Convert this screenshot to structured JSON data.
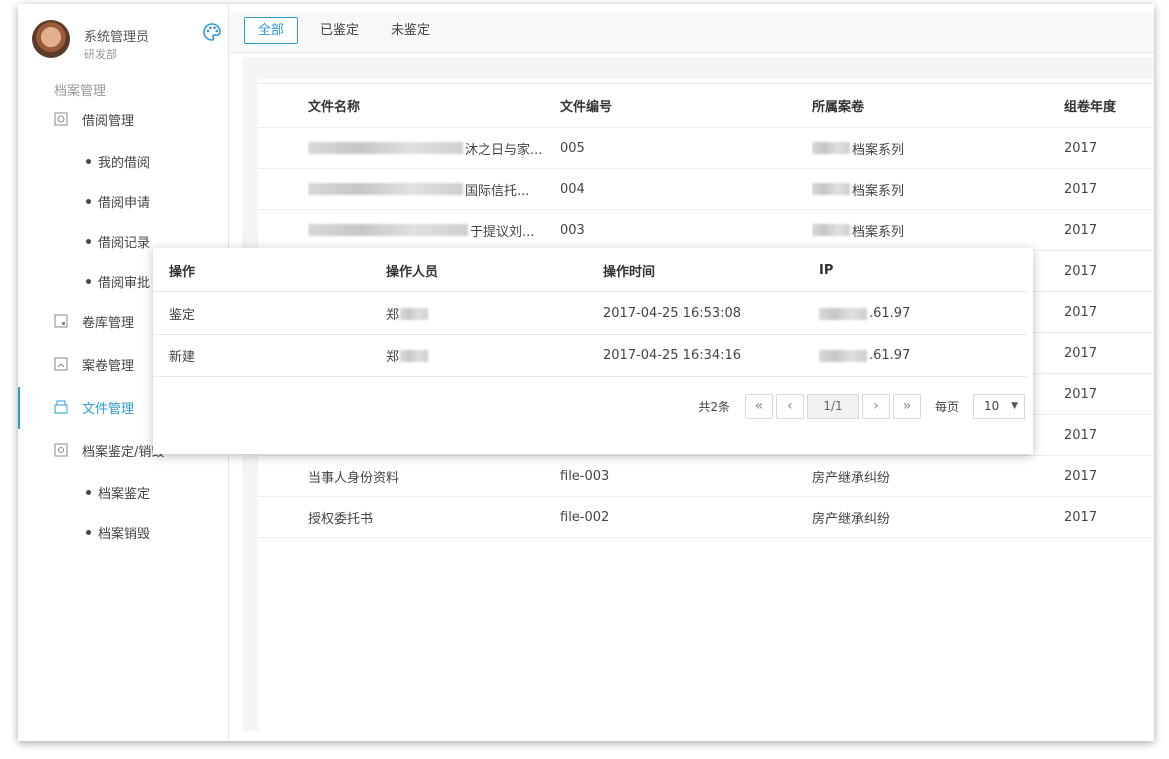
{
  "user": {
    "name": "系统管理员",
    "dept": "研发部"
  },
  "sidebar": {
    "section": "档案管理",
    "borrow": {
      "label": "借阅管理",
      "subs": [
        "我的借阅",
        "借阅申请",
        "借阅记录",
        "借阅审批"
      ]
    },
    "depot": "卷库管理",
    "volume": "案卷管理",
    "file": "文件管理",
    "appraise": {
      "label": "档案鉴定/销毁",
      "subs": [
        "档案鉴定",
        "档案销毁"
      ]
    }
  },
  "tabs": [
    "全部",
    "已鉴定",
    "未鉴定"
  ],
  "table": {
    "headers": [
      "文件名称",
      "文件编号",
      "所属案卷",
      "组卷年度"
    ],
    "rows": [
      {
        "name_suffix": "沐之日与家...",
        "code": "005",
        "volume_suffix": "档案系列",
        "year": "2017"
      },
      {
        "name_suffix": "国际信托...",
        "code": "004",
        "volume_suffix": "档案系列",
        "year": "2017"
      },
      {
        "name_suffix": "于提议刘...",
        "code": "003",
        "volume_suffix": "档案系列",
        "year": "2017"
      },
      {
        "name_suffix": "",
        "code": "",
        "volume_suffix": "",
        "year": "2017"
      },
      {
        "name_suffix": "",
        "code": "",
        "volume_suffix": "",
        "year": "2017"
      },
      {
        "name_suffix": "",
        "code": "",
        "volume_suffix": "",
        "year": "2017"
      },
      {
        "name_suffix": "",
        "code": "",
        "volume_suffix": "",
        "year": "2017"
      },
      {
        "name_suffix": "",
        "code": "",
        "volume_suffix": "",
        "year": "2017"
      },
      {
        "name_suffix": "当事人身份资料",
        "code": "file-003",
        "volume_suffix": "房产继承纠纷",
        "year": "2017"
      },
      {
        "name_suffix": "授权委托书",
        "code": "file-002",
        "volume_suffix": "房产继承纠纷",
        "year": "2017"
      }
    ]
  },
  "popup": {
    "headers": [
      "操作",
      "操作人员",
      "操作时间",
      "IP"
    ],
    "rows": [
      {
        "op": "鉴定",
        "user": "郑",
        "time": "2017-04-25 16:53:08",
        "ip": ".61.97"
      },
      {
        "op": "新建",
        "user": "郑",
        "time": "2017-04-25 16:34:16",
        "ip": ".61.97"
      }
    ],
    "pager": {
      "total": "共2条",
      "first": "«",
      "prev": "‹",
      "page": "1/1",
      "next": "›",
      "last": "»",
      "per_label": "每页",
      "per_value": "10"
    }
  }
}
